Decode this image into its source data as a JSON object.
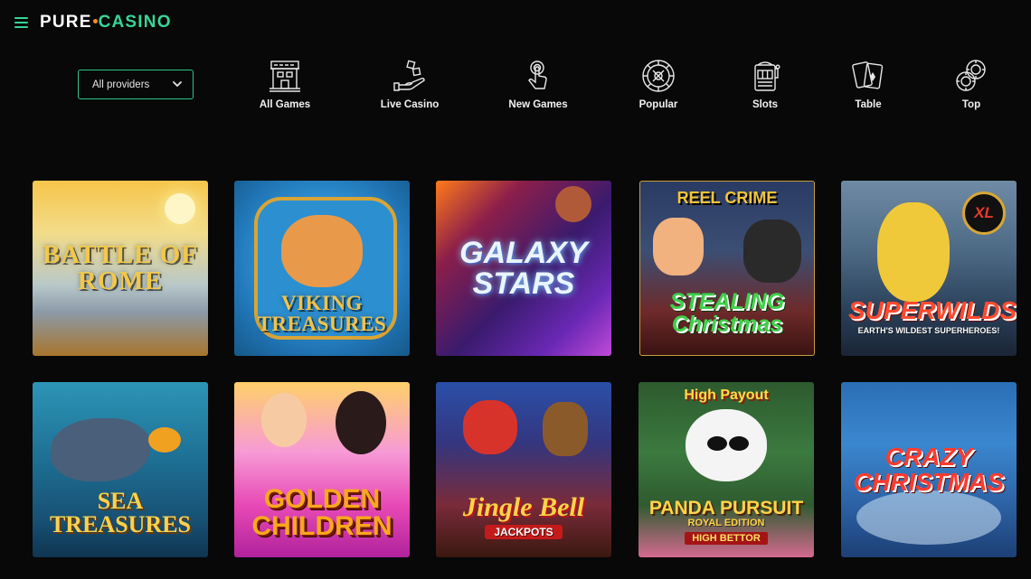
{
  "header": {
    "logo_left": "PURE",
    "logo_right": "CASINO",
    "menu_icon": "hamburger-menu-icon"
  },
  "filters": {
    "provider_select": {
      "selected": "All providers",
      "icon": "chevron-down-icon"
    }
  },
  "categories": [
    {
      "label": "All Games",
      "icon": "casino-building-icon"
    },
    {
      "label": "Live Casino",
      "icon": "dealer-hand-dice-icon"
    },
    {
      "label": "New Games",
      "icon": "touch-finger-icon"
    },
    {
      "label": "Popular",
      "icon": "roulette-wheel-icon"
    },
    {
      "label": "Slots",
      "icon": "slot-machine-icon"
    },
    {
      "label": "Table",
      "icon": "playing-cards-icon"
    },
    {
      "label": "Top",
      "icon": "casino-chips-icon"
    }
  ],
  "colors": {
    "accent": "#37d49b",
    "background": "#070807",
    "logo_dot": "#ff8a1f"
  },
  "games": [
    {
      "title": "BATTLE OF ROME"
    },
    {
      "title": "VIKING TREASURES"
    },
    {
      "title": "GALAXY STARS"
    },
    {
      "title": "STEALING Christmas",
      "badge": "REEL CRIME"
    },
    {
      "title": "SUPERWILDS",
      "subtitle": "EARTH'S WILDEST SUPERHEROES!",
      "badge": "XL"
    },
    {
      "title": "SEA TREASURES"
    },
    {
      "title": "GOLDEN CHILDREN"
    },
    {
      "title": "Jingle Bell",
      "subtitle": "JACKPOTS"
    },
    {
      "title": "PANDA PURSUIT",
      "subtitle": "ROYAL EDITION",
      "badge": "High Payout",
      "tag": "HIGH BETTOR"
    },
    {
      "title": "CRAZY CHRISTMAS"
    }
  ]
}
